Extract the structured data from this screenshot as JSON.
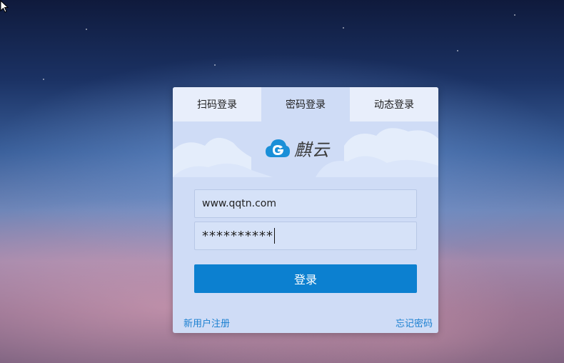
{
  "login": {
    "tabs": [
      {
        "label": "扫码登录"
      },
      {
        "label": "密码登录",
        "active": true
      },
      {
        "label": "动态登录"
      }
    ],
    "logo_text": "麒云",
    "username_value": "www.qqtn.com",
    "password_value": "**********",
    "login_button": "登录",
    "register_link": "新用户注册",
    "forgot_link": "忘记密码"
  },
  "colors": {
    "accent": "#0c80d0",
    "link": "#1a7fd0",
    "panel": "#cfdcf6",
    "tab_inactive": "#e8eefb"
  },
  "icons": [
    "mouse-cursor-icon",
    "cloud-logo-icon"
  ]
}
